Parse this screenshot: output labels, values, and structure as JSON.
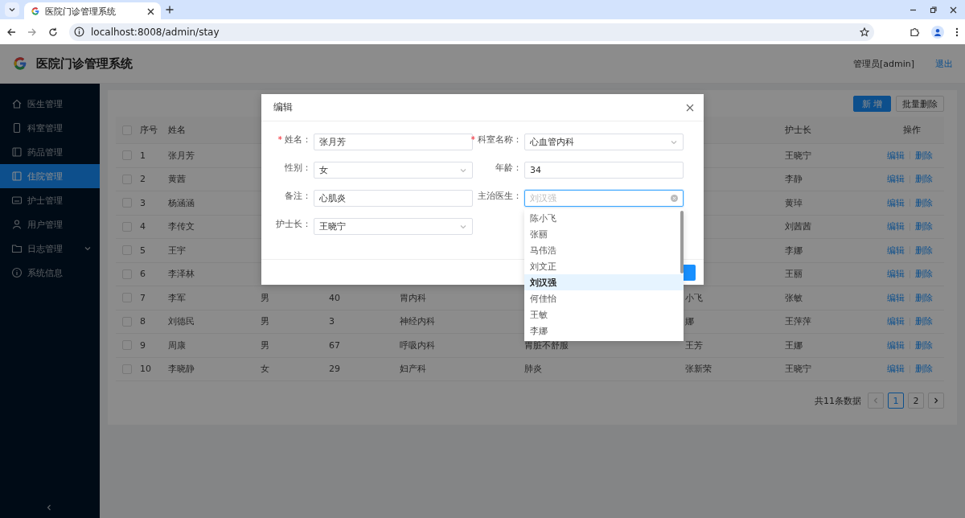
{
  "browser": {
    "tab_title": "医院门诊管理系统",
    "url": "localhost:8008/admin/stay"
  },
  "app": {
    "title": "医院门诊管理系统",
    "user": "管理员[admin]",
    "logout": "退出"
  },
  "sidebar": {
    "items": [
      {
        "label": "医生管理",
        "kind": "item",
        "selected": false
      },
      {
        "label": "科室管理",
        "kind": "item",
        "selected": false
      },
      {
        "label": "药品管理",
        "kind": "item",
        "selected": false
      },
      {
        "label": "住院管理",
        "kind": "item",
        "selected": true
      },
      {
        "label": "护士管理",
        "kind": "item",
        "selected": false
      },
      {
        "label": "用户管理",
        "kind": "item",
        "selected": false
      },
      {
        "label": "日志管理",
        "kind": "submenu",
        "selected": false
      },
      {
        "label": "系统信息",
        "kind": "item",
        "selected": false
      }
    ]
  },
  "toolbar": {
    "buttons": [
      {
        "label": "新 增",
        "kind": "primary"
      },
      {
        "label": "批量删除",
        "kind": "default"
      }
    ]
  },
  "table": {
    "header": {
      "checked": false,
      "seq": "序号",
      "name": "姓名",
      "nurse": "护士长",
      "actions": "操作"
    },
    "rows": [
      {
        "checked": false,
        "seq": "1",
        "name": "张月芳",
        "nurse": "王晓宁",
        "actions": [
          "编辑",
          "删除"
        ]
      },
      {
        "checked": false,
        "seq": "2",
        "name": "黄茜",
        "nurse": "李静",
        "actions": [
          "编辑",
          "删除"
        ]
      },
      {
        "checked": false,
        "seq": "3",
        "name": "杨涵涵",
        "nurse": "黄琸",
        "actions": [
          "编辑",
          "删除"
        ]
      },
      {
        "checked": false,
        "seq": "4",
        "name": "李传文",
        "nurse": "刘茜茜",
        "actions": [
          "编辑",
          "删除"
        ]
      },
      {
        "checked": false,
        "seq": "5",
        "name": "王宇",
        "nurse": "李娜",
        "actions": [
          "编辑",
          "删除"
        ]
      },
      {
        "checked": false,
        "seq": "6",
        "name": "李泽林",
        "nurse": "王丽",
        "actions": [
          "编辑",
          "删除"
        ]
      },
      {
        "checked": false,
        "seq": "7",
        "name": "李军",
        "column_3": "男",
        "column_4": "40",
        "column_5": "胃内科",
        "column_7": "小飞",
        "nurse": "张敏",
        "actions": [
          "编辑",
          "删除"
        ]
      },
      {
        "checked": false,
        "seq": "8",
        "name": "刘德民",
        "column_3": "男",
        "column_4": "3",
        "column_5": "神经内科",
        "column_7": "娜",
        "nurse": "王萍萍",
        "actions": [
          "编辑",
          "删除"
        ]
      },
      {
        "checked": false,
        "seq": "9",
        "name": "周康",
        "column_3": "男",
        "column_4": "67",
        "column_5": "呼吸内科",
        "column_6": "胃脏不舒服",
        "column_7": "王芳",
        "nurse": "王娜",
        "actions": [
          "编辑",
          "删除"
        ]
      },
      {
        "checked": false,
        "seq": "10",
        "name": "李晓静",
        "column_3": "女",
        "column_4": "29",
        "column_5": "妇产科",
        "column_6": "肺炎",
        "column_7": "张新荣",
        "nurse": "王晓宁",
        "actions": [
          "编辑",
          "删除"
        ]
      }
    ]
  },
  "pagination": {
    "total": "共11条数据",
    "prev": {
      "disabled": true
    },
    "next": {
      "disabled": false
    },
    "pages": [
      {
        "label": "1",
        "selected": true
      },
      {
        "label": "2",
        "selected": false
      }
    ]
  },
  "dialog": {
    "title": "编辑",
    "fields": [
      {
        "required_mark": "*",
        "label": "姓名：",
        "kind": "input",
        "value": "张月芳",
        "focused": false
      },
      {
        "required_mark": "*",
        "label": "科室名称：",
        "kind": "select",
        "value": "心血管内科",
        "focused": false
      },
      {
        "label": "性别：",
        "kind": "select",
        "value": "女",
        "focused": false
      },
      {
        "label": "年龄：",
        "kind": "input",
        "value": "34",
        "focused": false
      },
      {
        "label": "备注：",
        "kind": "input",
        "value": "心肌炎",
        "focused": false
      },
      {
        "label": "主治医生：",
        "kind": "select",
        "placeholder": "刘汉强",
        "focused": true
      },
      {
        "label": "护士长：",
        "kind": "select",
        "value": "王晓宁",
        "focused": false
      }
    ],
    "dropdown": {
      "options": [
        {
          "label": "陈小飞",
          "selected": false
        },
        {
          "label": "张丽",
          "selected": false
        },
        {
          "label": "马伟浩",
          "selected": false
        },
        {
          "label": "刘文正",
          "selected": false
        },
        {
          "label": "刘汉强",
          "selected": true
        },
        {
          "label": "何佳怡",
          "selected": false
        },
        {
          "label": "王敏",
          "selected": false
        },
        {
          "label": "李娜",
          "selected": false
        }
      ]
    }
  }
}
